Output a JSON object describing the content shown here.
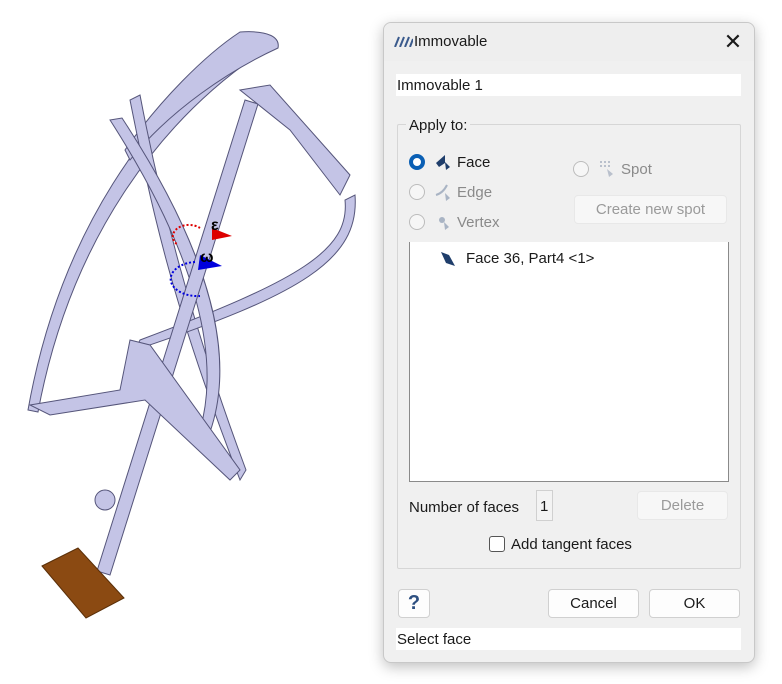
{
  "dialog": {
    "title": "Immovable",
    "title_icon": "immovable-hatch-icon",
    "name_value": "Immovable 1",
    "group_label": "Apply to:",
    "options": [
      {
        "label": "Face",
        "selected": true,
        "enabled": true,
        "icon": "face-select-icon"
      },
      {
        "label": "Edge",
        "selected": false,
        "enabled": false,
        "icon": "edge-select-icon"
      },
      {
        "label": "Vertex",
        "selected": false,
        "enabled": false,
        "icon": "vertex-select-icon"
      }
    ],
    "spot": {
      "label": "Spot",
      "selected": false,
      "enabled": false,
      "icon": "spot-icon"
    },
    "create_spot_label": "Create new spot",
    "list_items": [
      {
        "label": "Face 36, Part4 <1>",
        "icon": "face-icon"
      }
    ],
    "count_label": "Number of faces",
    "count_value": "1",
    "delete_label": "Delete",
    "tangent_label": "Add tangent faces",
    "tangent_checked": false,
    "help_label": "?",
    "cancel_label": "Cancel",
    "ok_label": "OK",
    "status": "Select face"
  },
  "viewport": {
    "epsilon_label": "ε",
    "omega_label": "ω",
    "model_color": "#c4c4e6",
    "base_color": "#8b4a12"
  }
}
